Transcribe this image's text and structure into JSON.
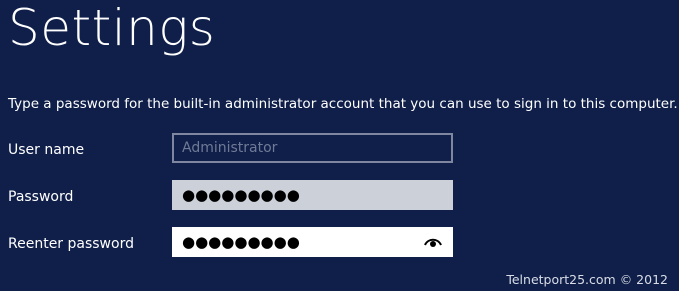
{
  "header": {
    "title": "Settings"
  },
  "instruction": "Type a password for the built-in administrator account that you can use to sign in to this computer.",
  "form": {
    "username": {
      "label": "User name",
      "placeholder": "Administrator",
      "value": ""
    },
    "password": {
      "label": "Password",
      "masked_value": "●●●●●●●●●"
    },
    "reenter_password": {
      "label": "Reenter password",
      "masked_value": "●●●●●●●●●",
      "reveal_icon": "eye-icon"
    }
  },
  "footer": {
    "text": "Telnetport25.com © 2012"
  },
  "colors": {
    "background": "#0f1f4a",
    "text": "#ffffff",
    "username_border": "#7e86a0",
    "password_field_bg": "#ccd0d9",
    "reenter_field_bg": "#ffffff"
  }
}
